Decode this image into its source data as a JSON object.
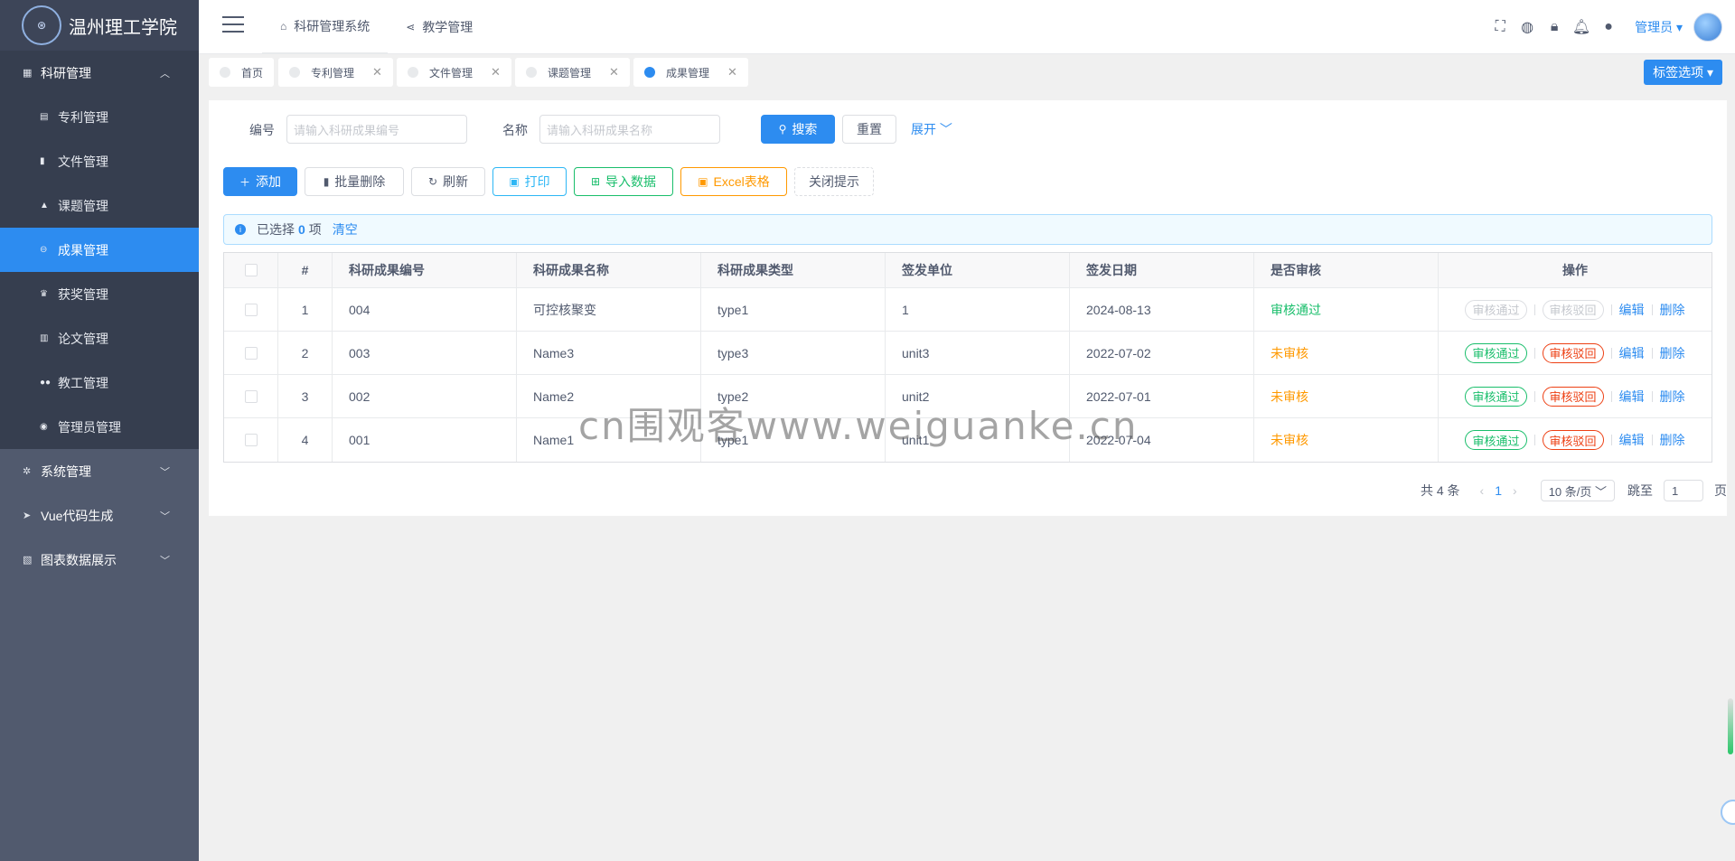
{
  "sidebar": {
    "logo_text": "温州理工学院",
    "groups": [
      {
        "label": "科研管理",
        "icon": "grid-icon",
        "open": true
      },
      {
        "label": "系统管理",
        "icon": "gear-icon"
      },
      {
        "label": "Vue代码生成",
        "icon": "send-icon"
      },
      {
        "label": "图表数据展示",
        "icon": "chart-icon"
      }
    ],
    "sub_items": [
      {
        "label": "专利管理",
        "icon": "book-icon"
      },
      {
        "label": "文件管理",
        "icon": "file-icon"
      },
      {
        "label": "课题管理",
        "icon": "flask-icon"
      },
      {
        "label": "成果管理",
        "icon": "minus-circle-icon",
        "active": true
      },
      {
        "label": "获奖管理",
        "icon": "trophy-icon"
      },
      {
        "label": "论文管理",
        "icon": "bookmark-icon"
      },
      {
        "label": "教工管理",
        "icon": "people-icon"
      },
      {
        "label": "管理员管理",
        "icon": "user-circle-icon"
      }
    ]
  },
  "header": {
    "top_nav": [
      {
        "label": "科研管理系统",
        "icon": "home-icon",
        "active": true
      },
      {
        "label": "教学管理",
        "icon": "share-icon"
      }
    ],
    "admin_label": "管理员"
  },
  "tags": {
    "items": [
      {
        "label": "首页",
        "closable": false
      },
      {
        "label": "专利管理",
        "closable": true
      },
      {
        "label": "文件管理",
        "closable": true
      },
      {
        "label": "课题管理",
        "closable": true
      },
      {
        "label": "成果管理",
        "closable": true,
        "active": true
      }
    ],
    "options_label": "标签选项"
  },
  "search": {
    "code_label": "编号",
    "code_placeholder": "请输入科研成果编号",
    "name_label": "名称",
    "name_placeholder": "请输入科研成果名称",
    "search_btn": "搜索",
    "reset_btn": "重置",
    "expand_link": "展开"
  },
  "toolbar": {
    "add": "添加",
    "batch_delete": "批量删除",
    "refresh": "刷新",
    "print": "打印",
    "import": "导入数据",
    "excel": "Excel表格",
    "close_tip": "关闭提示"
  },
  "alert": {
    "prefix": "已选择",
    "count": "0",
    "suffix": "项",
    "clear": "清空"
  },
  "table": {
    "columns": [
      "#",
      "科研成果编号",
      "科研成果名称",
      "科研成果类型",
      "签发单位",
      "签发日期",
      "是否审核",
      "操作"
    ],
    "rows": [
      {
        "idx": "1",
        "code": "004",
        "name": "可控核聚变",
        "type": "type1",
        "unit": "1",
        "date": "2024-08-13",
        "status": "审核通过",
        "status_kind": "ok",
        "disabled": true
      },
      {
        "idx": "2",
        "code": "003",
        "name": "Name3",
        "type": "type3",
        "unit": "unit3",
        "date": "2022-07-02",
        "status": "未审核",
        "status_kind": "wait",
        "disabled": false
      },
      {
        "idx": "3",
        "code": "002",
        "name": "Name2",
        "type": "type2",
        "unit": "unit2",
        "date": "2022-07-01",
        "status": "未审核",
        "status_kind": "wait",
        "disabled": false
      },
      {
        "idx": "4",
        "code": "001",
        "name": "Name1",
        "type": "type1",
        "unit": "unit1",
        "date": "2022-07-04",
        "status": "未审核",
        "status_kind": "wait",
        "disabled": false
      }
    ],
    "actions": {
      "approve": "审核通过",
      "reject": "审核驳回",
      "edit": "编辑",
      "delete": "删除"
    }
  },
  "pager": {
    "total": "共 4 条",
    "current": "1",
    "size": "10 条/页",
    "jump_label": "跳至",
    "jump_value": "1",
    "page_unit": "页"
  },
  "watermark": "cn围观客www.weiguanke.cn",
  "colors": {
    "primary": "#2d8cf0",
    "success": "#19be6b",
    "warning": "#ff9900",
    "error": "#ed4014",
    "sidebar": "#515a6e"
  }
}
